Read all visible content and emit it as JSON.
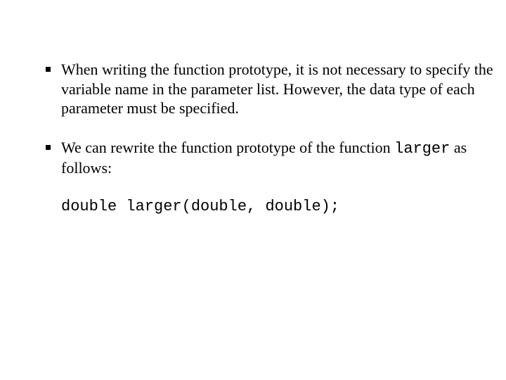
{
  "bullets": {
    "b1": {
      "text_a": "When writing the function prototype, it is not necessary to specify the variable name in the parameter list. However, the data type of each parameter must be specified."
    },
    "b2": {
      "text_a": "We can rewrite the function prototype of the function ",
      "code_inline": "larger",
      "text_b": " as follows:"
    }
  },
  "code": {
    "line1": "double larger(double, double);"
  }
}
